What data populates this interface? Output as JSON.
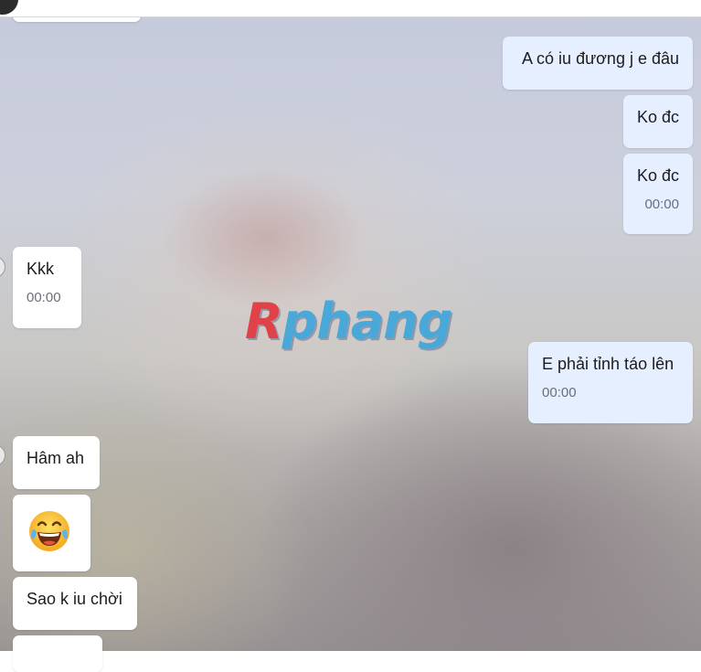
{
  "watermark": {
    "first": "R",
    "rest": "phang"
  },
  "messages": [
    {
      "side": "out",
      "text": "A có iu đương j e đâu"
    },
    {
      "side": "out",
      "text": "Ko đc"
    },
    {
      "side": "out",
      "text": "Ko đc",
      "time": "00:00"
    },
    {
      "side": "in",
      "text": "Kkk",
      "time": "00:00"
    },
    {
      "side": "out",
      "text": "E phải tỉnh táo lên",
      "time": "00:00"
    },
    {
      "side": "in",
      "text": "Hâm ah"
    },
    {
      "side": "in",
      "emoji": "face-with-tears-of-joy"
    },
    {
      "side": "in",
      "text": "Sao k iu chời"
    }
  ]
}
